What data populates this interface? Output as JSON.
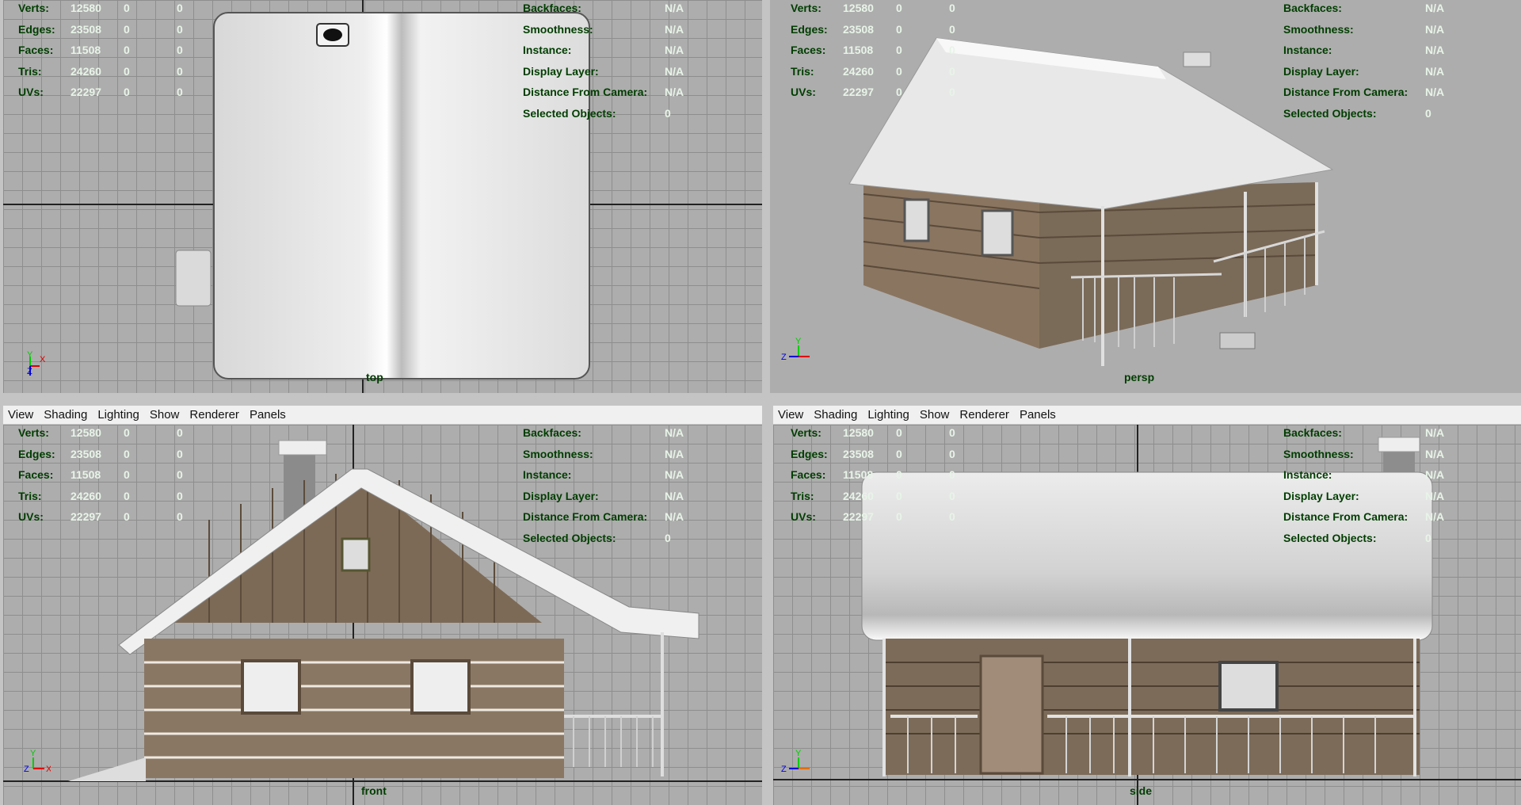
{
  "menu": [
    "View",
    "Shading",
    "Lighting",
    "Show",
    "Renderer",
    "Panels"
  ],
  "hud_left": [
    {
      "label": "Verts:",
      "v1": "12580",
      "v2": "0",
      "v3": "0"
    },
    {
      "label": "Edges:",
      "v1": "23508",
      "v2": "0",
      "v3": "0"
    },
    {
      "label": "Faces:",
      "v1": "11508",
      "v2": "0",
      "v3": "0"
    },
    {
      "label": "Tris:",
      "v1": "24260",
      "v2": "0",
      "v3": "0"
    },
    {
      "label": "UVs:",
      "v1": "22297",
      "v2": "0",
      "v3": "0"
    }
  ],
  "hud_right": [
    {
      "label": "Backfaces:",
      "value": "N/A"
    },
    {
      "label": "Smoothness:",
      "value": "N/A"
    },
    {
      "label": "Instance:",
      "value": "N/A"
    },
    {
      "label": "Display Layer:",
      "value": "N/A"
    },
    {
      "label": "Distance From Camera:",
      "value": "N/A"
    },
    {
      "label": "Selected Objects:",
      "value": "0"
    }
  ],
  "cameras": {
    "top": "top",
    "persp": "persp",
    "front": "front",
    "side": "side"
  },
  "axes": {
    "top": [
      "Y",
      "X",
      "Z"
    ],
    "persp": [
      "Y",
      "Z",
      "X"
    ],
    "front": [
      "Y",
      "Z",
      "X"
    ],
    "side": [
      "Y",
      "Z",
      "X"
    ]
  },
  "colors": {
    "viewport_bg": "#adadad",
    "grid": "#8e8e8e",
    "hud_label": "#003d00",
    "hud_value": "#e8f4e8",
    "active_border": "#7fa7d3"
  }
}
